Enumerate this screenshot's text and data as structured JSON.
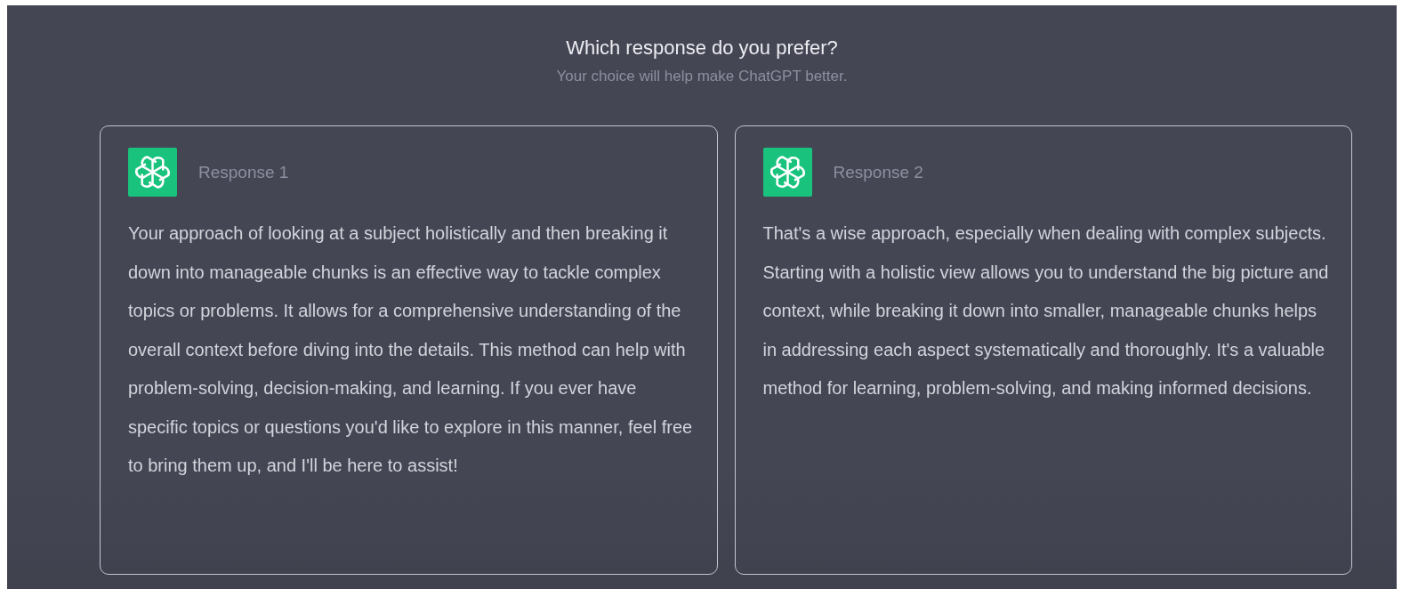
{
  "header": {
    "title": "Which response do you prefer?",
    "subtitle": "Your choice will help make ChatGPT better."
  },
  "responses": [
    {
      "label": "Response 1",
      "text": "Your approach of looking at a subject holistically and then breaking it down into manageable chunks is an effective way to tackle complex topics or problems. It allows for a comprehensive understanding of the overall context before diving into the details. This method can help with problem-solving, decision-making, and learning. If you ever have specific topics or questions you'd like to explore in this manner, feel free to bring them up, and I'll be here to assist!"
    },
    {
      "label": "Response 2",
      "text": "That's a wise approach, especially when dealing with complex subjects. Starting with a holistic view allows you to understand the big picture and context, while breaking it down into smaller, manageable chunks helps in addressing each aspect systematically and thoroughly. It's a valuable method for learning, problem-solving, and making informed decisions."
    }
  ]
}
